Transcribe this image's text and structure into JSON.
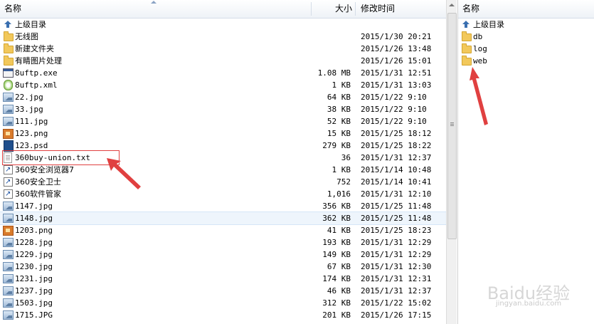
{
  "left_pane": {
    "columns": {
      "name": "名称",
      "size": "大小",
      "modified": "修改时间"
    },
    "up_label": "上级目录",
    "rows": [
      {
        "name": "无线图",
        "size": "",
        "time": "2015/1/30 20:21",
        "icon": "folder"
      },
      {
        "name": "新建文件夹",
        "size": "",
        "time": "2015/1/26 13:48",
        "icon": "folder"
      },
      {
        "name": "有睛图片处理",
        "size": "",
        "time": "2015/1/26 15:01",
        "icon": "folder"
      },
      {
        "name": "8uftp.exe",
        "size": "1.08 MB",
        "time": "2015/1/31 12:51",
        "icon": "exe"
      },
      {
        "name": "8uftp.xml",
        "size": "1 KB",
        "time": "2015/1/31 13:03",
        "icon": "xml"
      },
      {
        "name": "22.jpg",
        "size": "64 KB",
        "time": "2015/1/22 9:10",
        "icon": "image"
      },
      {
        "name": "33.jpg",
        "size": "38 KB",
        "time": "2015/1/22 9:10",
        "icon": "image"
      },
      {
        "name": "111.jpg",
        "size": "52 KB",
        "time": "2015/1/22 9:10",
        "icon": "image"
      },
      {
        "name": "123.png",
        "size": "15 KB",
        "time": "2015/1/25 18:12",
        "icon": "png"
      },
      {
        "name": "123.psd",
        "size": "279 KB",
        "time": "2015/1/25 18:22",
        "icon": "psd"
      },
      {
        "name": "360buy-union.txt",
        "size": "36",
        "time": "2015/1/31 12:37",
        "icon": "txt"
      },
      {
        "name": "360安全浏览器7",
        "size": "1 KB",
        "time": "2015/1/14 10:48",
        "icon": "shortcut"
      },
      {
        "name": "360安全卫士",
        "size": "752",
        "time": "2015/1/14 10:41",
        "icon": "shortcut"
      },
      {
        "name": "360软件管家",
        "size": "1,016",
        "time": "2015/1/31 12:10",
        "icon": "shortcut"
      },
      {
        "name": "1147.jpg",
        "size": "356 KB",
        "time": "2015/1/25 11:48",
        "icon": "image"
      },
      {
        "name": "1148.jpg",
        "size": "362 KB",
        "time": "2015/1/25 11:48",
        "icon": "image"
      },
      {
        "name": "1203.png",
        "size": "41 KB",
        "time": "2015/1/25 18:23",
        "icon": "png"
      },
      {
        "name": "1228.jpg",
        "size": "193 KB",
        "time": "2015/1/31 12:29",
        "icon": "image"
      },
      {
        "name": "1229.jpg",
        "size": "149 KB",
        "time": "2015/1/31 12:29",
        "icon": "image"
      },
      {
        "name": "1230.jpg",
        "size": "67 KB",
        "time": "2015/1/31 12:30",
        "icon": "image"
      },
      {
        "name": "1231.jpg",
        "size": "174 KB",
        "time": "2015/1/31 12:31",
        "icon": "image"
      },
      {
        "name": "1237.jpg",
        "size": "46 KB",
        "time": "2015/1/31 12:37",
        "icon": "image"
      },
      {
        "name": "1503.jpg",
        "size": "312 KB",
        "time": "2015/1/22 15:02",
        "icon": "image"
      },
      {
        "name": "1715.JPG",
        "size": "201 KB",
        "time": "2015/1/26 17:15",
        "icon": "image"
      }
    ]
  },
  "right_pane": {
    "column_name": "名称",
    "up_label": "上级目录",
    "folders": [
      "db",
      "log",
      "web"
    ]
  },
  "watermark": {
    "brand": "Baidu经验",
    "url": "jingyan.baidu.com"
  },
  "colors": {
    "annotation_red": "#e04040",
    "selected_row": "#eef5fc",
    "folder": "#f2c85b"
  }
}
